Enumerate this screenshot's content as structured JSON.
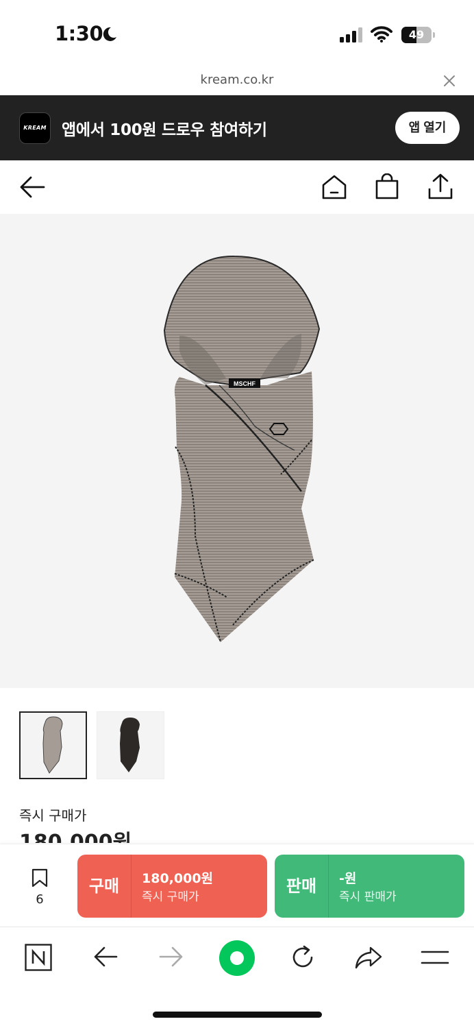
{
  "status_bar": {
    "time": "1:30",
    "battery": "49"
  },
  "browser": {
    "url": "kream.co.kr"
  },
  "app_banner": {
    "logo_text": "KREAM",
    "message": "앱에서 100원 드로우 참여하기",
    "open_label": "앱 열기"
  },
  "product": {
    "image_label": "MSCHF",
    "price_label": "즉시 구매가",
    "price": "180,000원"
  },
  "action_bar": {
    "bookmark_count": "6",
    "buy": {
      "label": "구매",
      "price": "180,000원",
      "caption": "즉시 구매가"
    },
    "sell": {
      "label": "판매",
      "price": "-원",
      "caption": "즉시 판매가"
    }
  },
  "colors": {
    "buy": "#ef6253",
    "sell": "#41b979",
    "banner": "#222222",
    "toolbar_accent": "#03c75a"
  },
  "icons": [
    "moon-icon",
    "signal-icon",
    "wifi-icon",
    "battery-icon",
    "close-icon",
    "back-arrow-icon",
    "home-icon",
    "shopping-bag-icon",
    "share-icon",
    "bookmark-icon",
    "naver-n-icon",
    "browser-back-icon",
    "browser-forward-icon",
    "green-dot-icon",
    "refresh-icon",
    "browser-share-icon",
    "menu-icon"
  ]
}
